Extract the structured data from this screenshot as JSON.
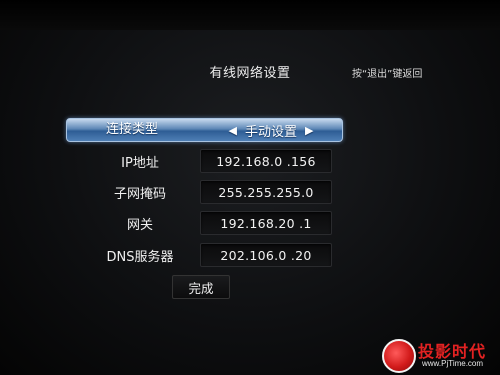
{
  "header": {
    "title": "有线网络设置",
    "hint": "按“退出”键返回"
  },
  "connection_type": {
    "label": "连接类型",
    "value": "手动设置",
    "left_arrow": "◀",
    "right_arrow": "▶"
  },
  "fields": {
    "ip": {
      "label": "IP地址",
      "value": "192.168.0  .156"
    },
    "subnet": {
      "label": "子网掩码",
      "value": "255.255.255.0"
    },
    "gateway": {
      "label": "网关",
      "value": "192.168.20 .1"
    },
    "dns": {
      "label": "DNS服务器",
      "value": "202.106.0  .20"
    }
  },
  "done_button": {
    "label": "完成"
  },
  "watermark": {
    "text": "投影时代",
    "url": "www.PjTime.com"
  },
  "colors": {
    "selection_bar": "#4f7fb5",
    "background": "#0e0f11",
    "watermark_red": "#e32222"
  }
}
